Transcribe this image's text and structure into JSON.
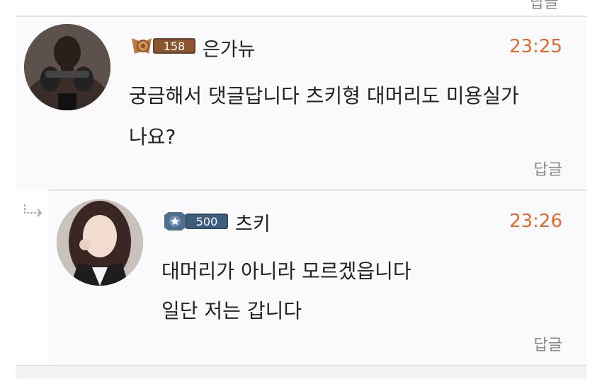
{
  "top_reply_label": "답글",
  "comments": [
    {
      "level": "158",
      "nickname": "은가뉴",
      "time": "23:25",
      "lines": [
        "궁금해서 댓글답니다 츠키형 대머리도 미용실가",
        "나요?"
      ],
      "reply_label": "답글",
      "level_icon": "bronze-wing-badge-icon"
    },
    {
      "level": "500",
      "nickname": "츠키",
      "time": "23:26",
      "lines": [
        "대머리가 아니라 모르겠읍니다",
        "일단 저는 갑니다"
      ],
      "reply_label": "답글",
      "level_icon": "steel-star-badge-icon"
    }
  ],
  "colors": {
    "time": "#e06a2c",
    "badge_bronze": "#b87840",
    "badge_steel": "#4e6e8e"
  }
}
